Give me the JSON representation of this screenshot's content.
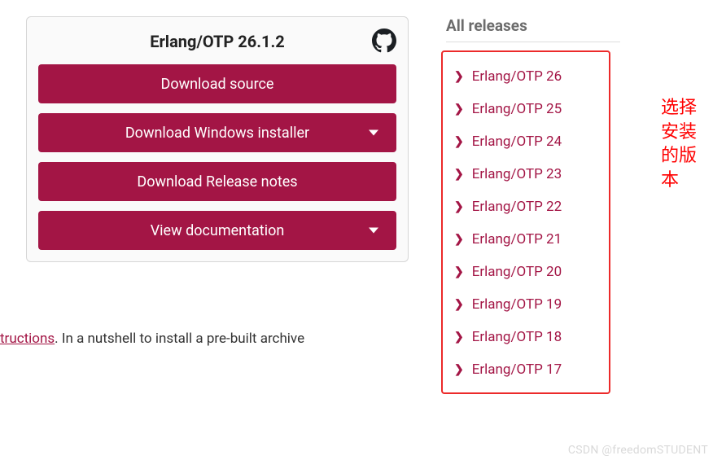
{
  "card": {
    "title": "Erlang/OTP 26.1.2",
    "github_icon": "github-icon"
  },
  "buttons": {
    "download_source": "Download source",
    "download_windows": "Download Windows installer",
    "download_notes": "Download Release notes",
    "view_docs": "View documentation"
  },
  "instructions": {
    "link_partial": "tructions",
    "text_after": ". In a nutshell to install a pre-built archive"
  },
  "releases": {
    "title": "All releases",
    "items": [
      "Erlang/OTP 26",
      "Erlang/OTP 25",
      "Erlang/OTP 24",
      "Erlang/OTP 23",
      "Erlang/OTP 22",
      "Erlang/OTP 21",
      "Erlang/OTP 20",
      "Erlang/OTP 19",
      "Erlang/OTP 18",
      "Erlang/OTP 17"
    ]
  },
  "annotation": "选择安装的版本",
  "watermark": "CSDN @freedomSTUDENT",
  "colors": {
    "brand": "#a31545",
    "highlight_border": "#ec2a2a",
    "annotation": "#ff0000"
  }
}
